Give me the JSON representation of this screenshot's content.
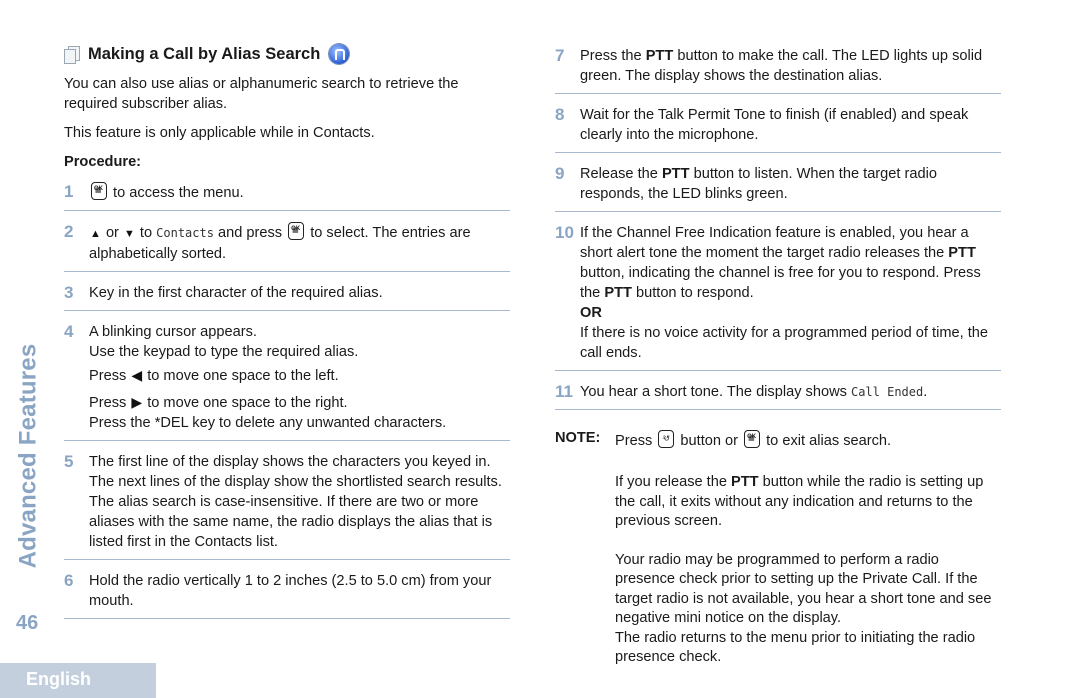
{
  "sidebar": {
    "section_title": "Advanced Features",
    "page_number": "46",
    "language_tab": "English"
  },
  "heading": {
    "title": "Making a Call by Alias Search"
  },
  "intro": {
    "paragraph1": "You can also use alias or alphanumeric search to retrieve the required subscriber alias.",
    "paragraph2": "This feature is only applicable while in Contacts.",
    "procedure_label": "Procedure:"
  },
  "steps": [
    {
      "num": "1",
      "after_key": " to access the menu."
    },
    {
      "num": "2",
      "or": " or ",
      "to": " to ",
      "menu_item": "Contacts",
      "and_press": " and press ",
      "after_key": " to select. The entries are alphabetically sorted."
    },
    {
      "num": "3",
      "text": "Key in the first character of the required alias."
    },
    {
      "num": "4",
      "line1": "A blinking cursor appears.",
      "line2": "Use the keypad to type the required alias.",
      "press": "Press ",
      "left_text": " to move one space to the left.",
      "right_text": " to move one space to the right.",
      "line5": "Press the *DEL key to delete any unwanted characters."
    },
    {
      "num": "5",
      "text1": "The first line of the display shows the characters you keyed in. The next lines of the display show the shortlisted search results.",
      "text2": "The alias search is case-insensitive. If there are two or more aliases with the same name, the radio displays the alias that is listed first in the Contacts list."
    },
    {
      "num": "6",
      "text": "Hold the radio vertically 1 to 2 inches (2.5 to 5.0 cm) from your mouth."
    },
    {
      "num": "7",
      "pre": "Press the ",
      "bold": "PTT",
      "post": " button to make the call. The LED lights up solid green. The display shows the destination alias."
    },
    {
      "num": "8",
      "text": "Wait for the Talk Permit Tone to finish (if enabled) and speak clearly into the microphone."
    },
    {
      "num": "9",
      "pre": "Release the ",
      "bold": "PTT",
      "post": " button to listen. When the target radio responds, the LED blinks green."
    },
    {
      "num": "10",
      "text1": "If the Channel Free Indication feature is enabled, you hear a short alert tone the moment the target radio releases the ",
      "bold1": "PTT",
      "text2": " button, indicating the channel is free for you to respond. Press the ",
      "bold2": "PTT",
      "text3": " button to respond.",
      "or": "OR",
      "text4": "If there is no voice activity for a programmed period of time, the call ends."
    },
    {
      "num": "11",
      "text": "You hear a short tone. The display shows ",
      "display": "Call Ended",
      "end": "."
    }
  ],
  "note": {
    "label": "NOTE:",
    "press": "Press ",
    "button_or": " button or ",
    "exit_text": " to exit alias search.",
    "para1_pre": "If you release the ",
    "para1_bold": "PTT",
    "para1_post": " button while the radio is setting up the call, it exits without any indication and returns to the previous screen.",
    "para2": "Your radio may be programmed to perform a radio presence check prior to setting up the Private Call. If the target radio is not available, you hear a short tone and see negative mini notice on the display.",
    "para3": "The radio returns to the menu prior to initiating the radio presence check."
  }
}
